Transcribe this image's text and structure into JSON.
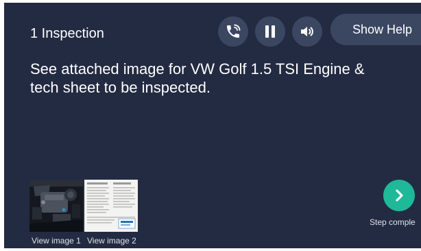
{
  "step": {
    "title": "1 Inspection",
    "instructions": "See attached image for VW Golf 1.5 TSI Engine & tech sheet to be inspected."
  },
  "controls": {
    "call_icon": "phone-call-icon",
    "pause_icon": "pause-icon",
    "speaker_icon": "speaker-icon",
    "help_label": "Show Help"
  },
  "attachments": [
    {
      "caption": "View image 1",
      "icon": "engine-photo"
    },
    {
      "caption": "View image 2",
      "icon": "tech-sheet-document"
    }
  ],
  "navigation": {
    "next_icon": "chevron-right-icon",
    "next_label": "Step comple"
  },
  "colors": {
    "background": "#232b42",
    "button": "#3b4761",
    "accent": "#1fb899",
    "text": "#ffffff"
  }
}
